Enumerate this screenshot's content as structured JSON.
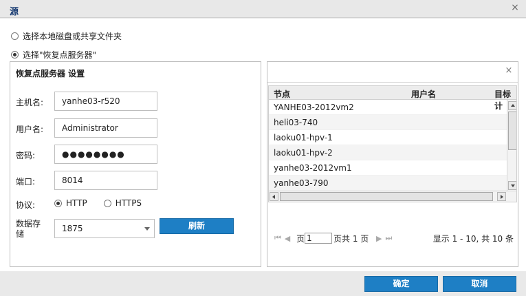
{
  "dialog": {
    "title": "源",
    "close_icon": "×"
  },
  "source": {
    "option_local": "选择本地磁盘或共享文件夹",
    "option_rps": "选择\"恢复点服务器\"",
    "selected": "option_rps"
  },
  "settings": {
    "title": "恢复点服务器 设置",
    "hostname_label": "主机名:",
    "hostname_value": "yanhe03-r520",
    "username_label": "用户名:",
    "username_value": "Administrator",
    "password_label": "密码:",
    "password_value": "●●●●●●●●",
    "port_label": "端口:",
    "port_value": "8014",
    "protocol_label": "协议:",
    "protocol_http": "HTTP",
    "protocol_https": "HTTPS",
    "protocol_selected": "HTTP",
    "datastore_label_line1": "数据存",
    "datastore_label_line2": "储",
    "datastore_value": "1875",
    "refresh_label": "刷新"
  },
  "grid": {
    "clear_icon": "×",
    "columns": [
      "节点",
      "用户名",
      "目标计"
    ],
    "rows": [
      {
        "node": "YANHE03-2012vm2"
      },
      {
        "node": "heli03-740"
      },
      {
        "node": "laoku01-hpv-1"
      },
      {
        "node": "laoku01-hpv-2"
      },
      {
        "node": "yanhe03-2012vm1"
      },
      {
        "node": "yanhe03-790"
      }
    ]
  },
  "pager": {
    "page_prefix": "页",
    "page_value": "1",
    "page_suffix": "页共 1 页",
    "info": "显示 1 - 10, 共 10 条"
  },
  "footer": {
    "ok_label": "确定",
    "cancel_label": "取消"
  },
  "colors": {
    "accent": "#1e7fc5",
    "title": "#1a3d73"
  }
}
